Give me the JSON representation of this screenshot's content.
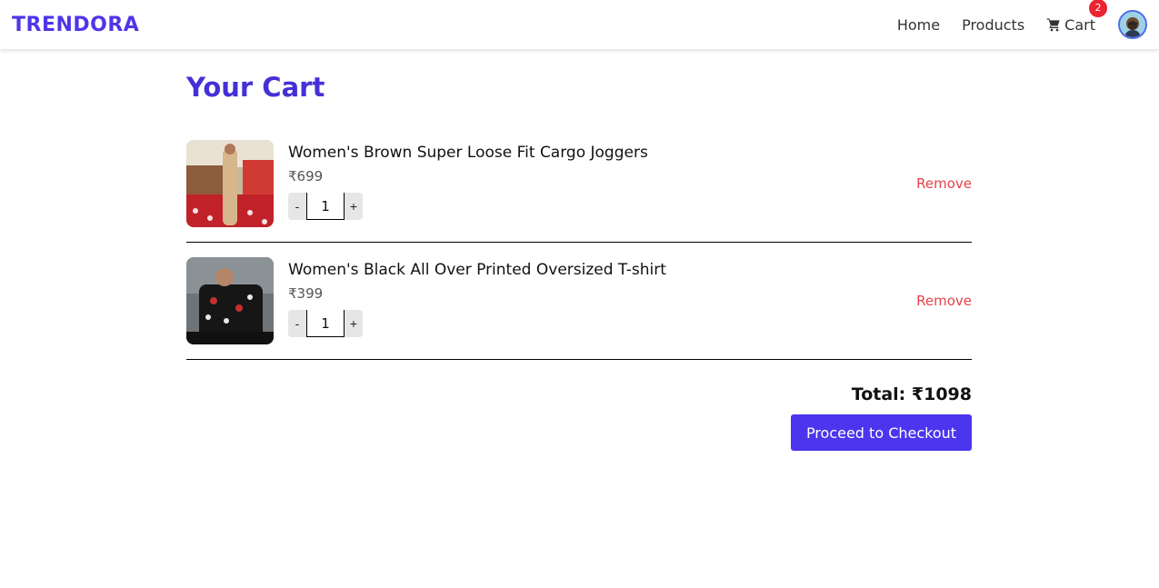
{
  "nav": {
    "brand": "TRENDORA",
    "links": [
      "Home",
      "Products"
    ],
    "cart_label": "Cart",
    "cart_count": "2"
  },
  "page": {
    "title": "Your Cart"
  },
  "items": [
    {
      "name": "Women's Brown Super Loose Fit Cargo Joggers",
      "price": "₹699",
      "qty": "1",
      "remove": "Remove"
    },
    {
      "name": "Women's Black All Over Printed Oversized T-shirt",
      "price": "₹399",
      "qty": "1",
      "remove": "Remove"
    }
  ],
  "qty_controls": {
    "minus": "-",
    "plus": "+"
  },
  "summary": {
    "total": "Total: ₹1098",
    "checkout": "Proceed to Checkout"
  },
  "colors": {
    "brand": "#4f35e8",
    "accent": "#4b35ee",
    "remove": "#e2434b",
    "badge": "#ec2330"
  }
}
